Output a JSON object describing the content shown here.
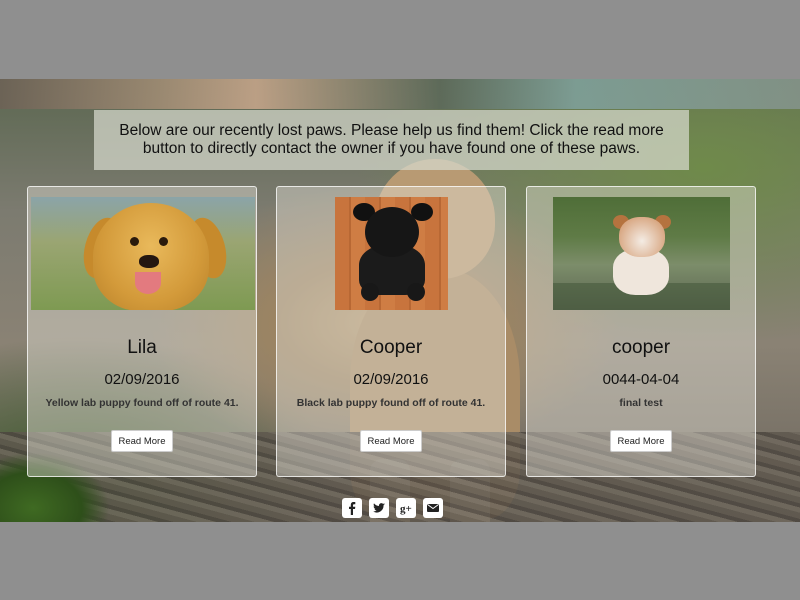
{
  "banner": {
    "text": "Below are our recently lost paws. Please help us find them! Click the read more button to directly contact the owner if you have found one of these paws."
  },
  "cards": [
    {
      "name": "Lila",
      "date": "02/09/2016",
      "description": "Yellow lab puppy found off of route 41.",
      "button": "Read More"
    },
    {
      "name": "Cooper",
      "date": "02/09/2016",
      "description": "Black lab puppy found off of route 41.",
      "button": "Read More"
    },
    {
      "name": "cooper",
      "date": "0044-04-04",
      "description": "final test",
      "button": "Read More"
    }
  ],
  "social": {
    "icons": [
      "facebook-icon",
      "twitter-icon",
      "google-plus-icon",
      "email-icon"
    ]
  }
}
